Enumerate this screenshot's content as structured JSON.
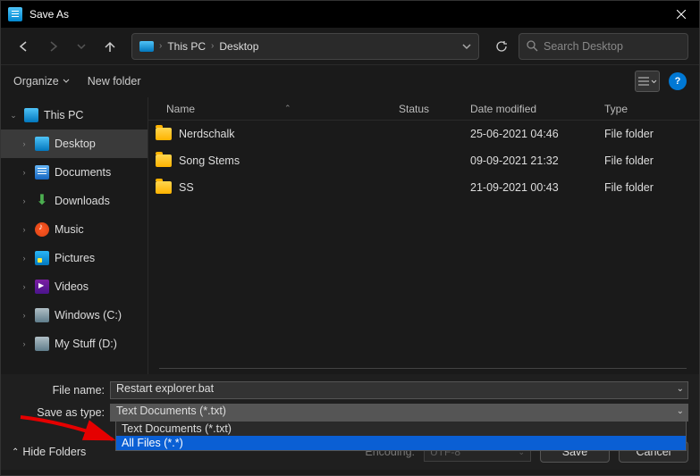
{
  "title": "Save As",
  "breadcrumb": {
    "root": "This PC",
    "folder": "Desktop"
  },
  "search": {
    "placeholder": "Search Desktop"
  },
  "toolbar": {
    "organize": "Organize",
    "newfolder": "New folder"
  },
  "sidebar": {
    "root": "This PC",
    "items": [
      {
        "label": "Desktop"
      },
      {
        "label": "Documents"
      },
      {
        "label": "Downloads"
      },
      {
        "label": "Music"
      },
      {
        "label": "Pictures"
      },
      {
        "label": "Videos"
      },
      {
        "label": "Windows (C:)"
      },
      {
        "label": "My Stuff (D:)"
      }
    ]
  },
  "columns": {
    "name": "Name",
    "status": "Status",
    "date": "Date modified",
    "type": "Type"
  },
  "files": [
    {
      "name": "Nerdschalk",
      "date": "25-06-2021 04:46",
      "type": "File folder"
    },
    {
      "name": "Song Stems",
      "date": "09-09-2021 21:32",
      "type": "File folder"
    },
    {
      "name": "SS",
      "date": "21-09-2021 00:43",
      "type": "File folder"
    }
  ],
  "form": {
    "filename_label": "File name:",
    "filename_value": "Restart explorer.bat",
    "type_label": "Save as type:",
    "type_value": "Text Documents (*.txt)",
    "options": [
      "Text Documents (*.txt)",
      "All Files  (*.*)"
    ],
    "encoding_label": "Encoding:",
    "encoding_value": "UTF-8",
    "hide": "Hide Folders",
    "save": "Save",
    "cancel": "Cancel"
  }
}
